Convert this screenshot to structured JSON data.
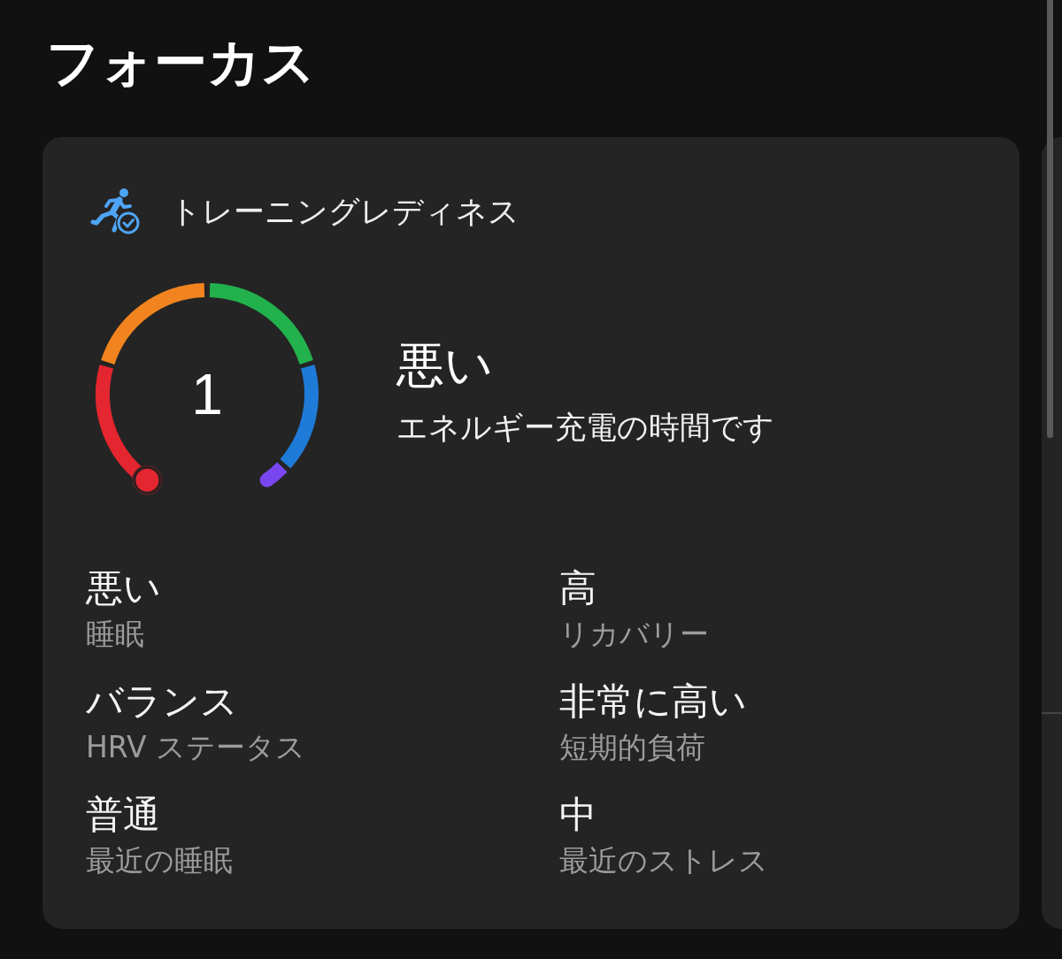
{
  "page": {
    "title": "フォーカス"
  },
  "card": {
    "title": "トレーニングレディネス",
    "gauge": {
      "value": "1",
      "level": 0.01
    },
    "status": "悪い",
    "message": "エネルギー充電の時間です",
    "metrics": [
      {
        "value": "悪い",
        "label": "睡眠"
      },
      {
        "value": "高",
        "label": "リカバリー"
      },
      {
        "value": "バランス",
        "label": "HRV ステータス"
      },
      {
        "value": "非常に高い",
        "label": "短期的負荷"
      },
      {
        "value": "普通",
        "label": "最近の睡眠"
      },
      {
        "value": "中",
        "label": "最近のストレス"
      }
    ]
  }
}
